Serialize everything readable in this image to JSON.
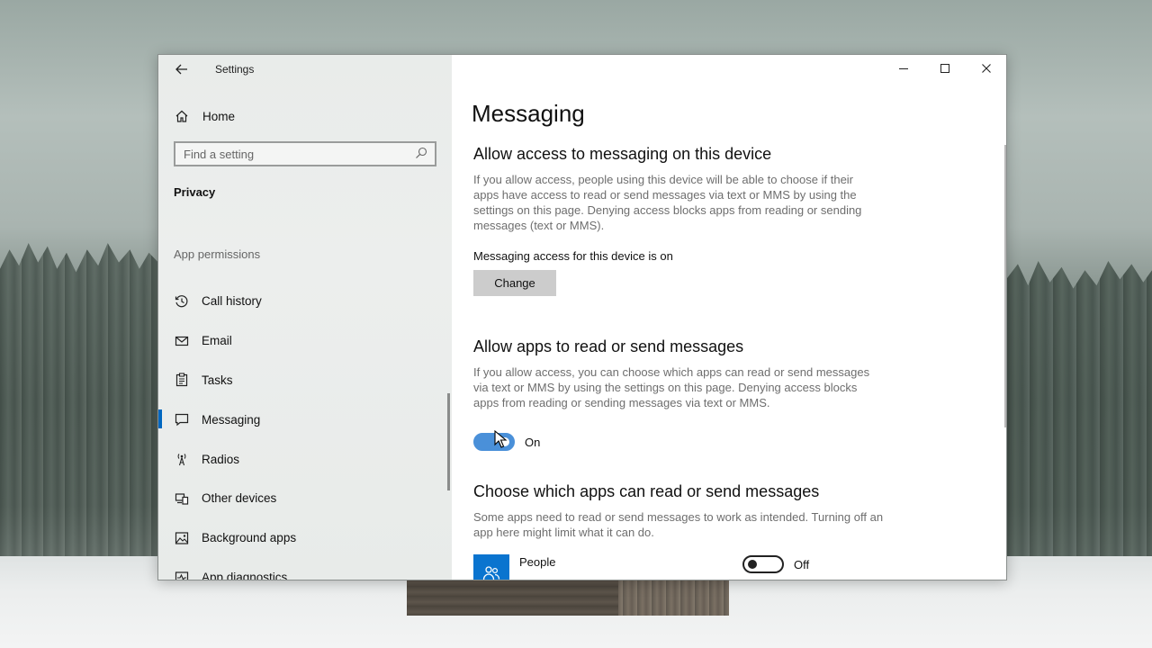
{
  "window": {
    "app_title": "Settings",
    "controls": {
      "minimize": "minimize",
      "maximize": "maximize",
      "close": "close"
    }
  },
  "sidebar": {
    "home_label": "Home",
    "search_placeholder": "Find a setting",
    "section_title": "Privacy",
    "group_label": "App permissions",
    "items": [
      {
        "label": "Call history",
        "icon": "history-icon",
        "active": false
      },
      {
        "label": "Email",
        "icon": "mail-icon",
        "active": false
      },
      {
        "label": "Tasks",
        "icon": "clipboard-icon",
        "active": false
      },
      {
        "label": "Messaging",
        "icon": "chat-icon",
        "active": true
      },
      {
        "label": "Radios",
        "icon": "antenna-icon",
        "active": false
      },
      {
        "label": "Other devices",
        "icon": "devices-icon",
        "active": false
      },
      {
        "label": "Background apps",
        "icon": "image-icon",
        "active": false
      },
      {
        "label": "App diagnostics",
        "icon": "diagnostics-icon",
        "active": false
      }
    ]
  },
  "main": {
    "page_title": "Messaging",
    "device_access": {
      "heading": "Allow access to messaging on this device",
      "description": "If you allow access, people using this device will be able to choose if their apps have access to read or send messages via text or MMS by using the settings on this page. Denying access blocks apps from reading or sending messages (text or MMS).",
      "status": "Messaging access for this device is on",
      "button_label": "Change"
    },
    "apps_access": {
      "heading": "Allow apps to read or send messages",
      "description": "If you allow access, you can choose which apps can read or send messages via text or MMS by using the settings on this page. Denying access blocks apps from reading or sending messages via text or MMS.",
      "toggle_state": "On",
      "toggle_on": true
    },
    "choose_apps": {
      "heading": "Choose which apps can read or send messages",
      "description": "Some apps need to read or send messages to work as intended. Turning off an app here might limit what it can do.",
      "apps": [
        {
          "name": "People",
          "toggle_state": "Off",
          "toggle_on": false
        }
      ]
    }
  },
  "colors": {
    "accent": "#0067c0",
    "toggle_on": "#4a90d9",
    "people_tile": "#0a74cf"
  }
}
